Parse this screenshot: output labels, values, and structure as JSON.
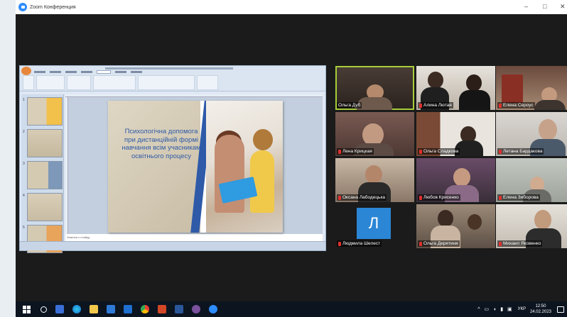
{
  "window": {
    "title": "Zoom Конференция",
    "controls": [
      "–",
      "□",
      "✕"
    ]
  },
  "slide": {
    "title": "Психологічна допомога при дистанційній формі навчання всім учасникам освітнього процесу"
  },
  "presentation": {
    "thumbnail_numbers": [
      "1",
      "2",
      "3",
      "4",
      "5"
    ],
    "notes_placeholder": "Заметки к слайду"
  },
  "participants": [
    {
      "name": "Ольга Дуб",
      "muted": false,
      "active": true
    },
    {
      "name": "Алина Лютая",
      "muted": true
    },
    {
      "name": "Елена Сероус",
      "muted": true
    },
    {
      "name": "Лена Крицкая",
      "muted": true
    },
    {
      "name": "Ольга Сладкова",
      "muted": true
    },
    {
      "name": "Летана Бардакова",
      "muted": true
    },
    {
      "name": "Оксана Лабодецька",
      "muted": true
    },
    {
      "name": "Любов Крисенко",
      "muted": true
    },
    {
      "name": "Елена Зиборова",
      "muted": true
    },
    {
      "name": "Людмила Шелест",
      "muted": true,
      "avatar_letter": "Л"
    },
    {
      "name": "Ольга Дерятиня",
      "muted": true
    },
    {
      "name": "Михаил Яковенко",
      "muted": true
    }
  ],
  "taskbar": {
    "apps": [
      "file-explorer-icon",
      "edge-icon",
      "explorer-folder-icon",
      "store-icon",
      "mail-icon",
      "chrome-icon",
      "powerpoint-icon",
      "word-icon",
      "viber-icon",
      "zoom-icon"
    ],
    "language": "УКР",
    "time": "12:50",
    "date": "24.02.2023"
  },
  "colors": {
    "active_speaker": "#a6ce39",
    "zoom_blue": "#2d8cff",
    "slide_blue": "#2e5aa8"
  }
}
